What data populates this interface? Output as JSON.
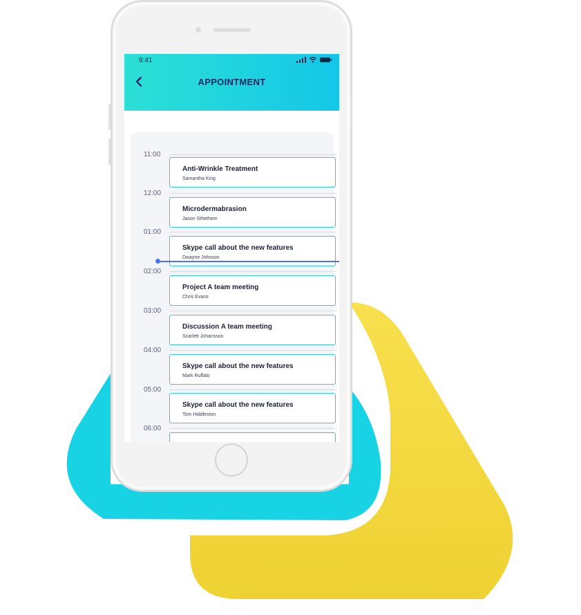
{
  "status_bar": {
    "time": "9:41"
  },
  "header": {
    "title": "APPOINTMENT"
  },
  "time_slots": [
    "11:00",
    "12:00",
    "01:00",
    "02:00",
    "03:00",
    "04:00",
    "05:00",
    "06:00"
  ],
  "appointments": [
    {
      "title": "Anti-Wrinkle Treatment",
      "person": "Samantha King"
    },
    {
      "title": "Microdermabrasion",
      "person": "Jason Sthethem"
    },
    {
      "title": "Skype call about the new features",
      "person": "Dwayne Johnson"
    },
    {
      "title": "Project A team meeting",
      "person": "Chris Evans"
    },
    {
      "title": "Discussion A team meeting",
      "person": "Scarlett Johansson"
    },
    {
      "title": "Skype call about the new features",
      "person": "Mark Ruffalo"
    },
    {
      "title": "Skype call about the new features",
      "person": "Tom Hiddleston"
    },
    {
      "title": "",
      "person": ""
    }
  ],
  "colors": {
    "header_gradient_start": "#2ce0d6",
    "header_gradient_end": "#14c7e8",
    "card_border": "#35c4e6",
    "current_time_line": "#4a73ee",
    "cyan_shape": "#17d3e3",
    "yellow_shape": "#f2d53c"
  },
  "icons": {
    "back": "chevron-left-icon",
    "signal": "signal-icon",
    "wifi": "wifi-icon",
    "battery": "battery-icon"
  }
}
